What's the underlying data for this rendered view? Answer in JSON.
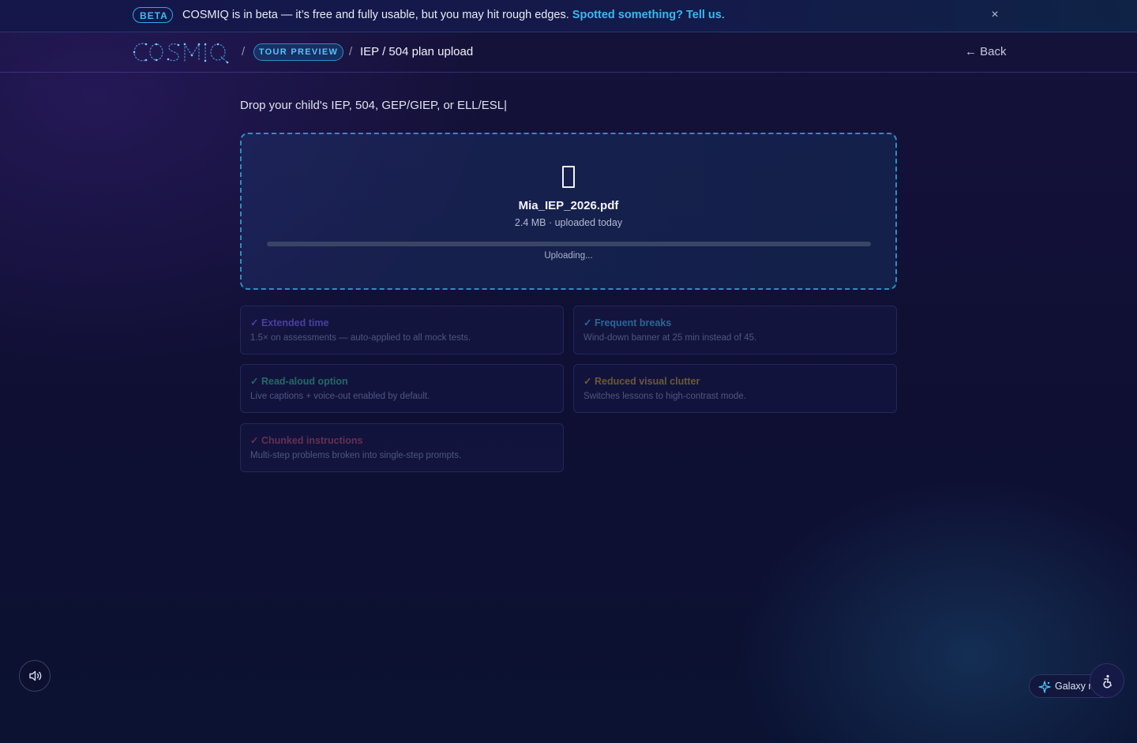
{
  "banner": {
    "badge": "BETA",
    "message": "COSMIQ is in beta — it’s free and fully usable, but you may hit rough edges.",
    "link_text": "Spotted something? Tell us",
    "trailing": ".",
    "close_glyph": "×"
  },
  "header": {
    "logo_text": "COSMIQ",
    "separator": "/",
    "tour_badge": "TOUR PREVIEW",
    "page_title": "IEP / 504 plan upload",
    "back_label": "← Back"
  },
  "upload": {
    "prompt": "Drop your child's IEP, 504, GEP/GIEP, or ELL/ESL|",
    "file_icon": "document-icon",
    "file_name": "Mia_IEP_2026.pdf",
    "file_meta": "2.4 MB · uploaded today",
    "progress_percent": 0,
    "status": "Uploading..."
  },
  "accommodations": [
    {
      "check": "✓",
      "title": "Extended time",
      "desc": "1.5× on assessments — auto-applied to all mock tests.",
      "color": "#4a3fa0"
    },
    {
      "check": "✓",
      "title": "Frequent breaks",
      "desc": "Wind-down banner at 25 min instead of 45.",
      "color": "#236a96"
    },
    {
      "check": "✓",
      "title": "Read-aloud option",
      "desc": "Live captions + voice-out enabled by default.",
      "color": "#216a66"
    },
    {
      "check": "✓",
      "title": "Reduced visual clutter",
      "desc": "Switches lessons to high-contrast mode.",
      "color": "#6a5a30"
    },
    {
      "check": "✓",
      "title": "Chunked instructions",
      "desc": "Multi-step problems broken into single-step prompts.",
      "color": "#6a2d52"
    }
  ],
  "floating": {
    "sound_icon": "speaker-icon",
    "galaxy_label": "Galaxy r",
    "galaxy_icon": "sparkle-icon",
    "accessibility_icon": "accessibility-icon"
  }
}
